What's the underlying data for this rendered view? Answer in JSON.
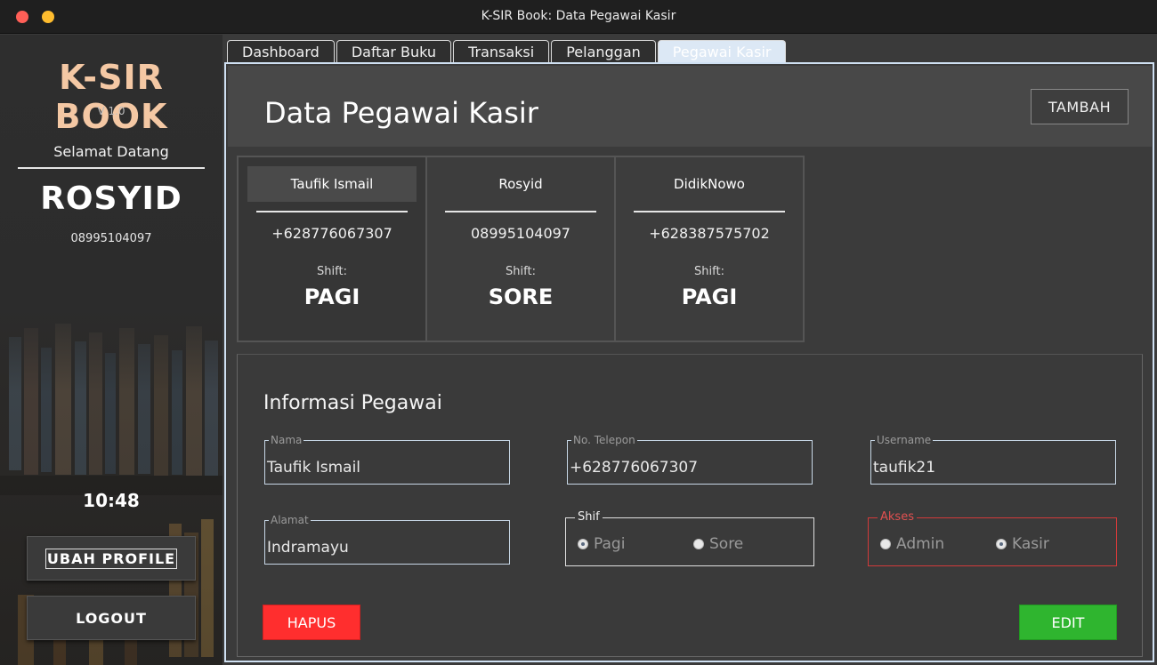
{
  "window": {
    "title": "K-SIR Book: Data Pegawai Kasir"
  },
  "sidebar": {
    "brand": "K-SIR BOOK",
    "version": "V 1.0",
    "welcome": "Selamat Datang",
    "user_name": "ROSYID",
    "user_phone": "08995104097",
    "clock": "10:48",
    "profile_button": "UBAH PROFILE",
    "logout_button": "LOGOUT"
  },
  "tabs": [
    {
      "label": "Dashboard"
    },
    {
      "label": "Daftar Buku"
    },
    {
      "label": "Transaksi"
    },
    {
      "label": "Pelanggan"
    },
    {
      "label": "Pegawai Kasir",
      "active": true
    }
  ],
  "main": {
    "title": "Data Pegawai Kasir",
    "add_button": "TAMBAH",
    "cards": [
      {
        "name": "Taufik Ismail",
        "phone": "+628776067307",
        "shift_label": "Shift:",
        "shift": "PAGI",
        "selected": true
      },
      {
        "name": "Rosyid",
        "phone": "08995104097",
        "shift_label": "Shift:",
        "shift": "SORE"
      },
      {
        "name": "DidikNowo",
        "phone": "+628387575702",
        "shift_label": "Shift:",
        "shift": "PAGI"
      }
    ],
    "info": {
      "title": "Informasi Pegawai",
      "nama": {
        "label": "Nama",
        "value": "Taufik Ismail"
      },
      "telepon": {
        "label": "No. Telepon",
        "value": "+628776067307"
      },
      "username": {
        "label": "Username",
        "value": "taufik21"
      },
      "alamat": {
        "label": "Alamat",
        "value": "Indramayu"
      },
      "shif": {
        "label": "Shif",
        "options": [
          "Pagi",
          "Sore"
        ],
        "selected": "Pagi"
      },
      "akses": {
        "label": "Akses",
        "options": [
          "Admin",
          "Kasir"
        ],
        "selected": "Kasir"
      },
      "delete_button": "HAPUS",
      "edit_button": "EDIT"
    }
  },
  "colors": {
    "accent_brand": "#f4c8a4",
    "delete": "#ff2e2e",
    "edit": "#2fb52f",
    "tab_active": "#dce8f5",
    "akses_border": "#d23a3a"
  }
}
